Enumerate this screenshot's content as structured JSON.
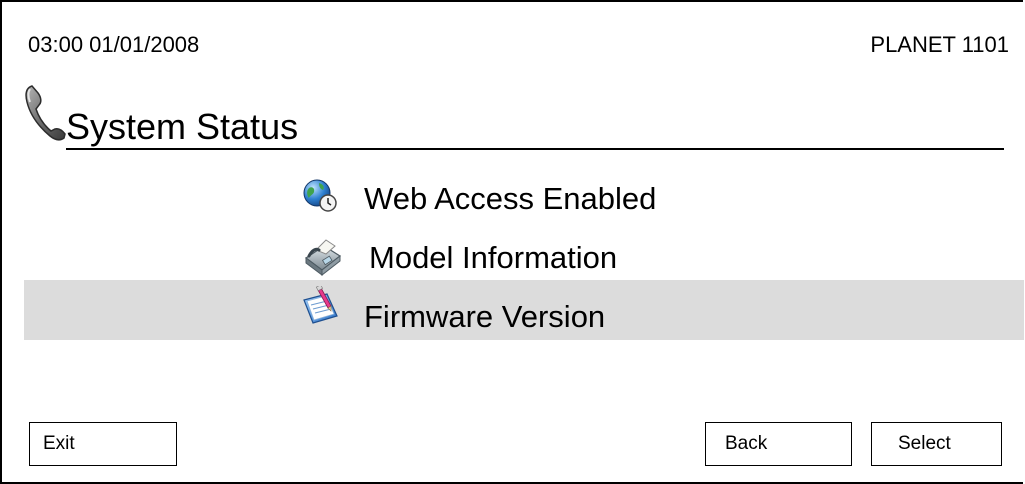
{
  "status_bar": {
    "datetime": "03:00 01/01/2008",
    "model": "PLANET 1101"
  },
  "header": {
    "title": "System Status",
    "icon": "telephone-handset-icon"
  },
  "menu": {
    "items": [
      {
        "label": "Web Access Enabled",
        "icon": "globe-clock-icon",
        "selected": false
      },
      {
        "label": "Model Information",
        "icon": "fax-machine-icon",
        "selected": false
      },
      {
        "label": "Firmware Version",
        "icon": "notepad-pencil-icon",
        "selected": true
      }
    ]
  },
  "softkeys": {
    "exit": "Exit",
    "back": "Back",
    "select": "Select"
  },
  "colors": {
    "selected_row": "#dcdcdc",
    "border": "#000000",
    "background": "#ffffff"
  }
}
